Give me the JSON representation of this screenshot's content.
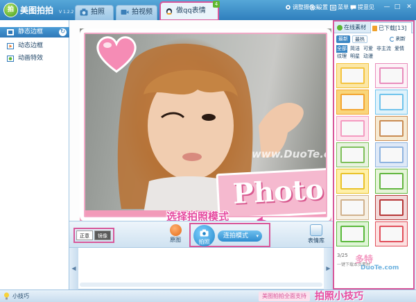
{
  "app": {
    "name": "美图拍拍",
    "version": "V 1.2.2",
    "logo_text": "拍"
  },
  "tabs": [
    {
      "label": "拍照",
      "icon": "camera-icon"
    },
    {
      "label": "拍视频",
      "icon": "video-icon"
    },
    {
      "label": "做qq表情",
      "icon": "penguin-icon",
      "badge": "4"
    }
  ],
  "toolbar": {
    "camera": "调整摄像头",
    "settings": "设置",
    "menu": "菜单",
    "feedback": "提意见"
  },
  "window_controls": {
    "minimize": "—",
    "maximize": "□",
    "close": "✕"
  },
  "sidebar": {
    "items": [
      {
        "label": "静态边框",
        "icon": "frame-icon",
        "active": true
      },
      {
        "label": "动态边框",
        "icon": "animated-frame-icon"
      },
      {
        "label": "动画特效",
        "icon": "effect-icon"
      }
    ]
  },
  "stage": {
    "watermark": "www.DuoTe.com",
    "banner_text": "Photo",
    "hint": "选择拍照模式"
  },
  "actionbar": {
    "orient_normal": "正意",
    "orient_mirror": "镜像",
    "original": "原图",
    "shutter": "拍照",
    "mode": "连拍模式",
    "mode_caret": "▾",
    "emoji_lib": "表情库"
  },
  "filmstrip": {
    "left_arrow": "◀",
    "right_arrow": "▶"
  },
  "right_panel": {
    "tab_online": "在线素材",
    "tab_downloaded": "已下载[13]",
    "latest": "最新",
    "hot": "最热",
    "refresh": "刷新",
    "categories": [
      "全部",
      "简洁",
      "可爱",
      "非主流",
      "爱情",
      "纹理",
      "明星",
      "动漫"
    ],
    "thumbnails": [
      {
        "bg": "#fbe7a6",
        "frame": "#f4c33f"
      },
      {
        "bg": "#fdf2f7",
        "frame": "#e88cbc"
      },
      {
        "bg": "#f9d57a",
        "frame": "#f3a531"
      },
      {
        "bg": "#dff2fb",
        "frame": "#6fc3ec"
      },
      {
        "bg": "#fde3ec",
        "frame": "#f39ac0"
      },
      {
        "bg": "#f6ead2",
        "frame": "#c98b53"
      },
      {
        "bg": "#e8f3e0",
        "frame": "#7fbf5a"
      },
      {
        "bg": "#dfe9f7",
        "frame": "#8fb4e0"
      },
      {
        "bg": "#fff0a8",
        "frame": "#e9c22a"
      },
      {
        "bg": "#e5f4d8",
        "frame": "#63b640"
      },
      {
        "bg": "#f7f0e4",
        "frame": "#d0b18c"
      },
      {
        "bg": "#f2d8d8",
        "frame": "#b63636"
      },
      {
        "bg": "#dff5d6",
        "frame": "#59b83a"
      },
      {
        "bg": "#fce1e1",
        "frame": "#e14e5a"
      }
    ],
    "pager": "3/25",
    "batch": "一键下载本页素材"
  },
  "brand_stamp": {
    "cn": "多特",
    "en": "DuoTe.com"
  },
  "status": {
    "tip": "小技巧",
    "toast": "美图拍拍全面支持",
    "bottom_logo": "拍照小技巧"
  },
  "colors": {
    "accent": "#d8579a",
    "title_bar": "#3b8ccb",
    "hint": "#e64aa0"
  }
}
